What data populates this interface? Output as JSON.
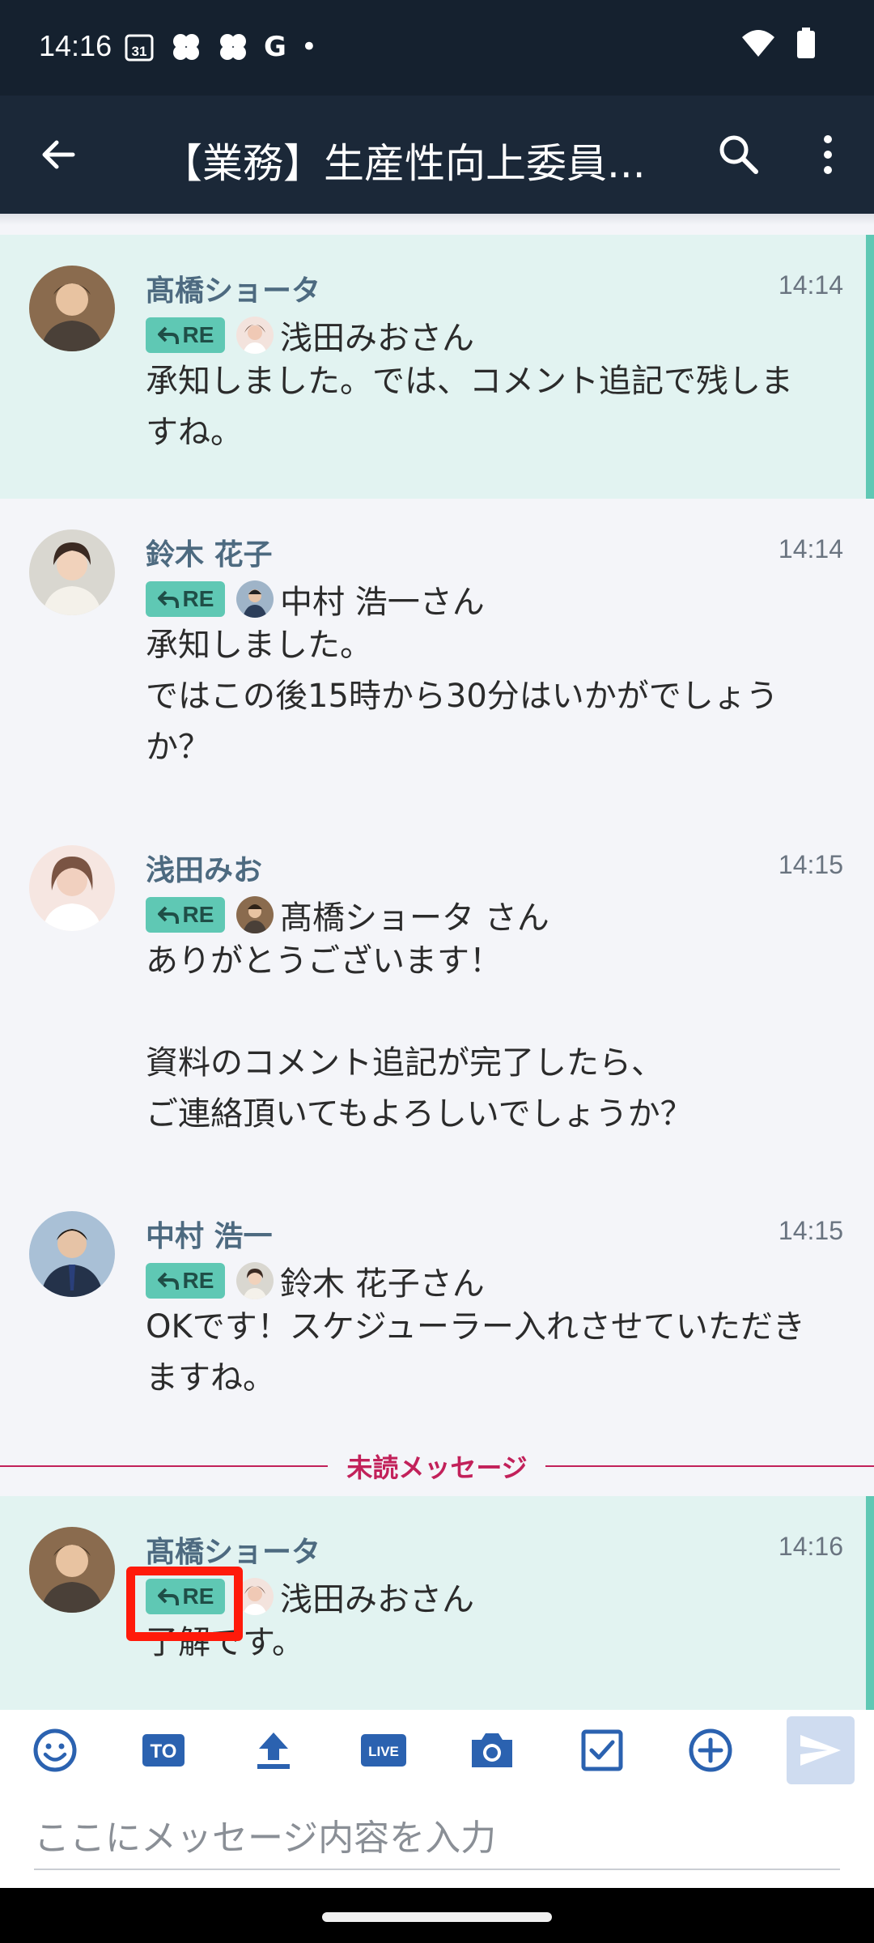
{
  "status_bar": {
    "time": "14:16",
    "calendar": "31",
    "g_letter": "G",
    "dot": "•"
  },
  "header": {
    "title": "【業務】生産性向上委員..."
  },
  "messages": [
    {
      "sender": "髙橋ショータ",
      "time": "14:14",
      "re": "RE",
      "reply_to": "浅田みおさん",
      "body": "承知しました。では、コメント追記で残しま\nすね。",
      "highlighted": true
    },
    {
      "sender": "鈴木 花子",
      "time": "14:14",
      "re": "RE",
      "reply_to": "中村 浩一さん",
      "body": "承知しました。\nではこの後15時から30分はいかがでしょう\nか？",
      "highlighted": false
    },
    {
      "sender": "浅田みお",
      "time": "14:15",
      "re": "RE",
      "reply_to": "髙橋ショータ さん",
      "body": "ありがとうございます！\n\n資料のコメント追記が完了したら、\nご連絡頂いてもよろしいでしょうか？",
      "highlighted": false
    },
    {
      "sender": "中村 浩一",
      "time": "14:15",
      "re": "RE",
      "reply_to": "鈴木 花子さん",
      "body": "OKです！スケジューラー入れさせていただき\nますね。",
      "highlighted": false
    },
    {
      "sender": "髙橋ショータ",
      "time": "14:16",
      "re": "RE",
      "reply_to": "浅田みおさん",
      "body": "了解です。",
      "highlighted": true
    }
  ],
  "unread_divider": "未読メッセージ",
  "toolbar": {
    "icons": [
      "emoji-icon",
      "to-icon",
      "upload-icon",
      "live-icon",
      "camera-icon",
      "task-icon",
      "plus-icon",
      "send-icon"
    ],
    "to_label": "TO",
    "live_label": "LIVE"
  },
  "input": {
    "placeholder": "ここにメッセージ内容を入力"
  },
  "colors": {
    "accent": "#5fc8b4",
    "unread": "#c2215a",
    "header": "#1b2838",
    "highlight_bg": "#e2f3f1"
  }
}
